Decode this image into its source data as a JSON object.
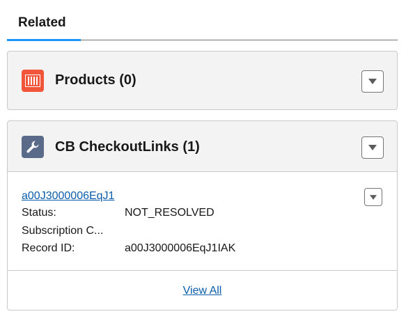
{
  "tabs": [
    {
      "label": "Related"
    }
  ],
  "products_card": {
    "title": "Products (0)",
    "icon": "products-icon",
    "icon_color": "#f2563a"
  },
  "checkout_card": {
    "title": "CB CheckoutLinks (1)",
    "icon": "wrench-icon",
    "icon_color": "#5a6b8a",
    "record": {
      "link": "a00J3000006EqJ1",
      "fields": [
        {
          "label": "Status:",
          "value": "NOT_RESOLVED"
        },
        {
          "label": "Subscription C...",
          "value": ""
        },
        {
          "label": "Record ID:",
          "value": "a00J3000006EqJ1IAK"
        }
      ]
    },
    "footer_link": "View All"
  },
  "colors": {
    "accent": "#1b96ff",
    "link": "#0b5cab",
    "card_header_bg": "#f3f3f3",
    "border": "#c9c9c9"
  }
}
